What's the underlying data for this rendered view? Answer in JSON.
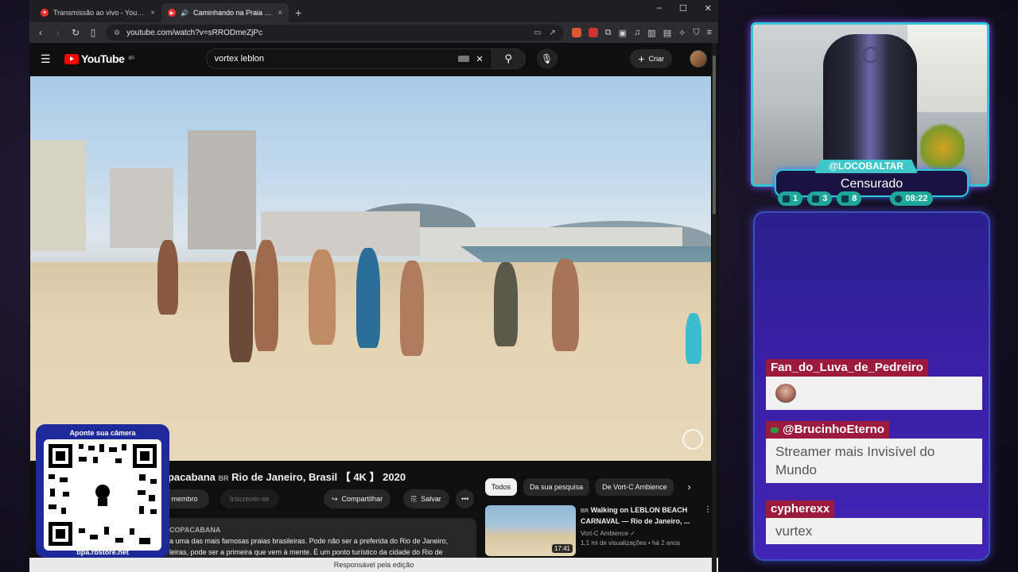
{
  "browser": {
    "tabs": [
      {
        "title": "Transmissão ao vivo - YouTube Studio",
        "active": false
      },
      {
        "title": "Caminhando na Praia de Copacabana",
        "active": true
      }
    ],
    "url": "youtube.com/watch?v=sRRODmeZjPc"
  },
  "youtube": {
    "logo_text": "YouTube",
    "logo_region": "BR",
    "search_query": "vortex leblon",
    "create_label": "Criar",
    "video_title_prefix": "opacabana",
    "video_title_region": "BR",
    "video_title_rest": "Rio de Janeiro, Brasil 【 4K 】 2020",
    "member_label": "eja membro",
    "subscribe_label": "Inscrever-se",
    "share_label": "Compartilhar",
    "save_label": "Salvar",
    "description_channel": "COPACABANA",
    "description_line1": "a uma das mais famosas praias brasileiras. Pode não ser a preferida do Rio de Janeiro,",
    "description_line2": "leiras, pode ser a primeira que vem à mente. É um ponto turístico da cidade do Rio de",
    "chips": [
      "Todos",
      "Da sua pesquisa",
      "De Vort-C Ambience"
    ],
    "recommendation": {
      "region": "BR",
      "title": "Walking on LEBLON BEACH CARNAVAL — Rio de Janeiro, ...",
      "channel": "Vort-C Ambience",
      "views": "1,1 mi de visualizações",
      "age": "há 2 anos",
      "duration": "17:41"
    },
    "status_text": "Responsável pela edição"
  },
  "qr": {
    "top_text": "Aponte sua câmera",
    "bottom_text": "tipa.rbstore.net"
  },
  "stream": {
    "username": "@LOCOBALTAR",
    "status": "Censurado",
    "stats": [
      {
        "icon": "twitch-icon",
        "value": "1"
      },
      {
        "icon": "youtube-icon",
        "value": "3"
      },
      {
        "icon": "kick-icon",
        "value": "8"
      },
      {
        "icon": "clock-icon",
        "value": "08:22"
      }
    ]
  },
  "chat": {
    "messages": [
      {
        "user": "Fan_do_Luva_de_Pedreiro",
        "text": ""
      },
      {
        "user": "@BrucinhoEterno",
        "text": "Streamer mais Invisível do Mundo"
      },
      {
        "user": "cypherexx",
        "text": "vurtex"
      }
    ]
  },
  "colors": {
    "youtube_red": "#ff0000",
    "overlay_cyan": "#2ec8d8",
    "chat_name_bg": "#9c1a3b",
    "qr_card_bg": "#1e2a9a"
  }
}
